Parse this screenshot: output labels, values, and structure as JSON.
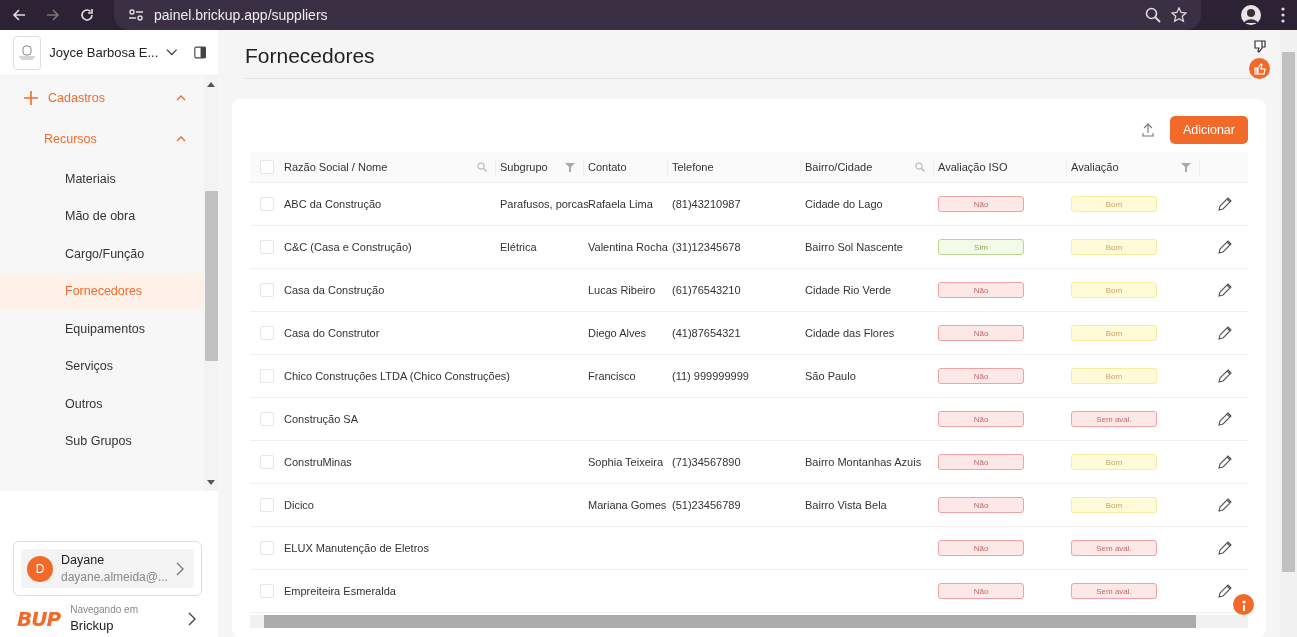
{
  "browser": {
    "url": "painel.brickup.app/suppliers"
  },
  "sidebar": {
    "workspace": "Joyce Barbosa E...",
    "items": [
      {
        "label": "Cadastros",
        "expanded": true,
        "selected": false,
        "children": [
          {
            "label": "Recursos",
            "expanded": true,
            "selected": false,
            "children": [
              {
                "label": "Materiais",
                "selected": false
              },
              {
                "label": "Mão de obra",
                "selected": false
              },
              {
                "label": "Cargo/Função",
                "selected": false
              },
              {
                "label": "Fornecedores",
                "selected": true
              },
              {
                "label": "Equipamentos",
                "selected": false
              },
              {
                "label": "Serviços",
                "selected": false
              },
              {
                "label": "Outros",
                "selected": false
              },
              {
                "label": "Sub Grupos",
                "selected": false
              }
            ]
          }
        ]
      }
    ],
    "user": {
      "initial": "D",
      "name": "Dayane",
      "email": "dayane.almeida@..."
    },
    "context": {
      "logo": "BUP",
      "caption": "Navegando em",
      "name": "Brickup"
    }
  },
  "page": {
    "title": "Fornecedores"
  },
  "toolbar": {
    "add_button": "Adicionar"
  },
  "table": {
    "header_checked": false,
    "columns": [
      {
        "label": "Razão Social / Nome",
        "kind": "search"
      },
      {
        "label": "Subgrupo",
        "kind": "filter"
      },
      {
        "label": "Contato",
        "kind": "plain"
      },
      {
        "label": "Telefone",
        "kind": "plain"
      },
      {
        "label": "Bairro/Cidade",
        "kind": "search"
      },
      {
        "label": "Avaliação ISO",
        "kind": "plain"
      },
      {
        "label": "Avaliação",
        "kind": "filter"
      }
    ],
    "rows": [
      {
        "checked": false,
        "name": "ABC da Construção",
        "subgroup": "Parafusos, porcas",
        "contact": "Rafaela Lima",
        "phone": "(81)43210987",
        "location": "Cidade do Lago",
        "iso": {
          "text": "Não",
          "kind": "negative"
        },
        "rating": {
          "text": "Bom",
          "kind": "good"
        }
      },
      {
        "checked": false,
        "name": "C&C (Casa e Construção)",
        "subgroup": "Elétrica",
        "contact": "Valentina Rocha",
        "phone": "(31)12345678",
        "location": "Bairro Sol Nascente",
        "iso": {
          "text": "Sim",
          "kind": "positive"
        },
        "rating": {
          "text": "Bom",
          "kind": "good"
        }
      },
      {
        "checked": false,
        "name": "Casa da Construção",
        "contact": "Lucas Ribeiro",
        "phone": "(61)76543210",
        "location": "Cidade Rio Verde",
        "iso": {
          "text": "Não",
          "kind": "negative"
        },
        "rating": {
          "text": "Bom",
          "kind": "good"
        }
      },
      {
        "checked": false,
        "name": "Casa do Construtor",
        "contact": "Diego Alves",
        "phone": "(41)87654321",
        "location": "Cidade das Flores",
        "iso": {
          "text": "Não",
          "kind": "negative"
        },
        "rating": {
          "text": "Bom",
          "kind": "good"
        }
      },
      {
        "checked": false,
        "name": "Chico Construções LTDA (Chico Construções)",
        "contact": "Francisco",
        "phone": "(11) 999999999",
        "location": "São Paulo",
        "iso": {
          "text": "Não",
          "kind": "negative"
        },
        "rating": {
          "text": "Bom",
          "kind": "good"
        }
      },
      {
        "checked": false,
        "name": "Construção SA",
        "iso": {
          "text": "Não",
          "kind": "negative"
        },
        "rating": {
          "text": "Sem aval.",
          "kind": "negative"
        }
      },
      {
        "checked": false,
        "name": "ConstruMinas",
        "contact": "Sophia Teixeira",
        "phone": "(71)34567890",
        "location": "Bairro Montanhas Azuis",
        "iso": {
          "text": "Não",
          "kind": "negative"
        },
        "rating": {
          "text": "Bom",
          "kind": "good"
        }
      },
      {
        "checked": false,
        "name": "Dicico",
        "contact": "Mariana Gomes",
        "phone": "(51)23456789",
        "location": "Bairro Vista Bela",
        "iso": {
          "text": "Não",
          "kind": "negative"
        },
        "rating": {
          "text": "Bom",
          "kind": "good"
        }
      },
      {
        "checked": false,
        "name": "ELUX Manutenção de Eletros",
        "iso": {
          "text": "Não",
          "kind": "negative"
        },
        "rating": {
          "text": "Sem aval.",
          "kind": "negative"
        }
      },
      {
        "checked": false,
        "name": "Empreiteira Esmeralda",
        "iso": {
          "text": "Não",
          "kind": "negative"
        },
        "rating": {
          "text": "Sem aval.",
          "kind": "negative"
        }
      }
    ]
  }
}
